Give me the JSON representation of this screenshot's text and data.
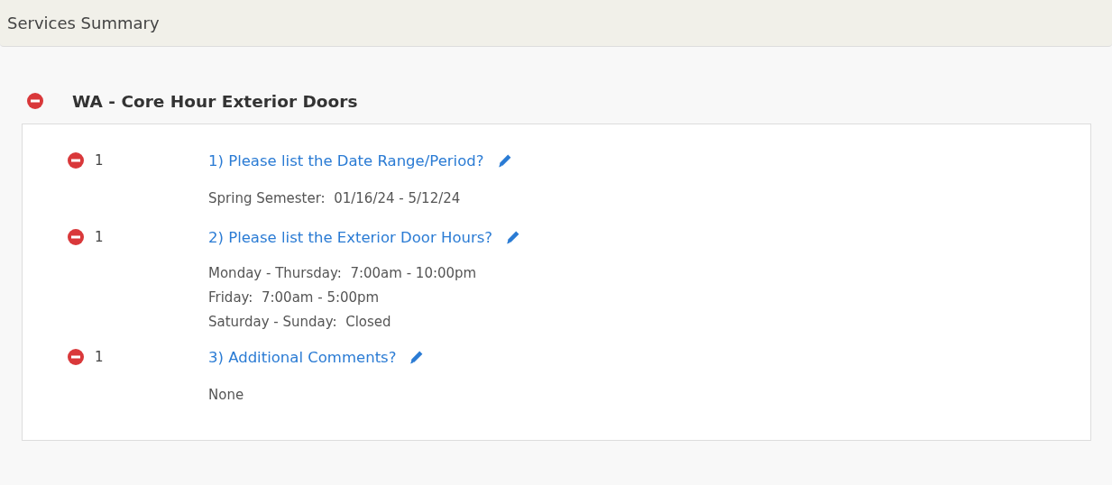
{
  "panel": {
    "title": "Services Summary"
  },
  "service": {
    "title": "WA - Core Hour Exterior Doors",
    "questions": [
      {
        "quantity": "1",
        "question": "1) Please list the Date Range/Period?",
        "answer": [
          "Spring Semester:  01/16/24 - 5/12/24"
        ]
      },
      {
        "quantity": "1",
        "question": "2) Please list the Exterior Door Hours?",
        "answer": [
          "Monday - Thursday:  7:00am - 10:00pm",
          "Friday:  7:00am - 5:00pm",
          "Saturday - Sunday:  Closed"
        ]
      },
      {
        "quantity": "1",
        "question": "3) Additional Comments?",
        "answer": [
          "None"
        ]
      }
    ]
  }
}
